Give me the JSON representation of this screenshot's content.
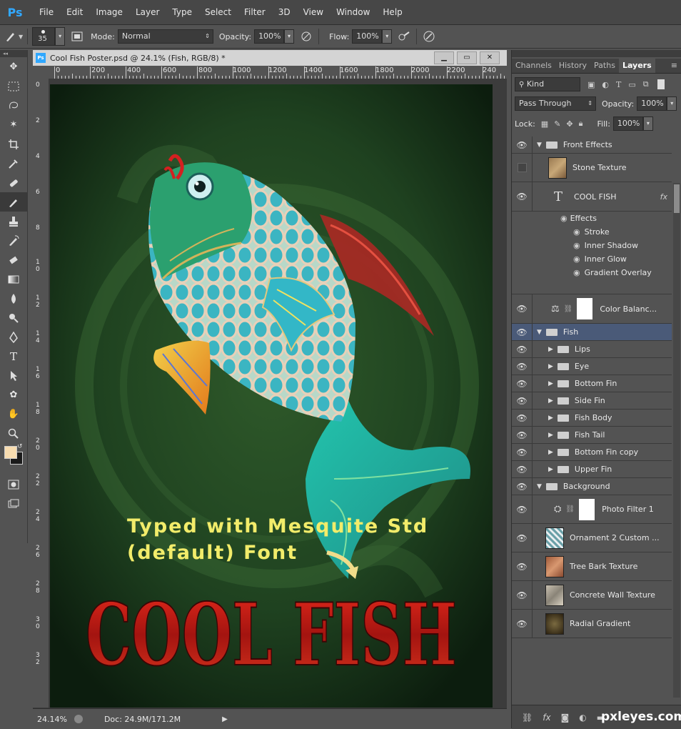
{
  "app": {
    "logo": "Ps"
  },
  "menu": [
    "File",
    "Edit",
    "Image",
    "Layer",
    "Type",
    "Select",
    "Filter",
    "3D",
    "View",
    "Window",
    "Help"
  ],
  "options": {
    "brush_size": "35",
    "mode_label": "Mode:",
    "mode_value": "Normal",
    "opacity_label": "Opacity:",
    "opacity_value": "100%",
    "flow_label": "Flow:",
    "flow_value": "100%"
  },
  "document": {
    "title": "Cool Fish Poster.psd @ 24.1% (Fish, RGB/8) *",
    "ruler_h": [
      "0",
      "200",
      "400",
      "600",
      "800",
      "1000",
      "1200",
      "1400",
      "1600",
      "1800",
      "2000",
      "2200",
      "240"
    ],
    "ruler_v": [
      "0",
      "2",
      "4",
      "6",
      "8",
      "1 0",
      "1 2",
      "1 4",
      "1 6",
      "1 8",
      "2 0",
      "2 2",
      "2 4",
      "2 6",
      "2 8",
      "3 0",
      "3 2"
    ],
    "zoom": "24.14%",
    "doc_size": "Doc: 24.9M/171.2M",
    "annotation_line1": "Typed with Mesquite Std",
    "annotation_line2": "(default) Font",
    "poster_title": "COOL FISH"
  },
  "panel": {
    "tabs": [
      "Channels",
      "History",
      "Paths",
      "Layers"
    ],
    "active_tab": "Layers",
    "filter_kind": "Kind",
    "blend_mode": "Pass Through",
    "opacity_label": "Opacity:",
    "opacity_value": "100%",
    "lock_label": "Lock:",
    "fill_label": "Fill:",
    "fill_value": "100%",
    "layers": [
      {
        "name": "Front Effects",
        "kind": "group-open"
      },
      {
        "name": "Stone Texture",
        "kind": "image"
      },
      {
        "name": "COOL FISH",
        "kind": "text"
      },
      {
        "name": "Effects",
        "kind": "effect-head"
      },
      {
        "name": "Stroke",
        "kind": "effect"
      },
      {
        "name": "Inner Shadow",
        "kind": "effect"
      },
      {
        "name": "Inner Glow",
        "kind": "effect"
      },
      {
        "name": "Gradient Overlay",
        "kind": "effect"
      },
      {
        "name": "Color Balanc...",
        "kind": "adjust"
      },
      {
        "name": "Fish",
        "kind": "group-open"
      },
      {
        "name": "Lips",
        "kind": "group"
      },
      {
        "name": "Eye",
        "kind": "group"
      },
      {
        "name": "Bottom Fin",
        "kind": "group"
      },
      {
        "name": "Side Fin",
        "kind": "group"
      },
      {
        "name": "Fish Body",
        "kind": "group"
      },
      {
        "name": "Fish Tail",
        "kind": "group"
      },
      {
        "name": "Bottom Fin copy",
        "kind": "group"
      },
      {
        "name": "Upper Fin",
        "kind": "group"
      },
      {
        "name": "Background",
        "kind": "group-open"
      },
      {
        "name": "Photo Filter 1",
        "kind": "adjust"
      },
      {
        "name": "Ornament 2 Custom ...",
        "kind": "image"
      },
      {
        "name": "Tree Bark Texture",
        "kind": "image"
      },
      {
        "name": "Concrete Wall Texture",
        "kind": "image"
      },
      {
        "name": "Radial Gradient",
        "kind": "image"
      }
    ]
  },
  "watermark": "pxleyes.com",
  "colors": {
    "accent": "#31a8ff",
    "selected": "#4a5a78",
    "poster_bg": "#1f3d1f",
    "title_red": "#c01818",
    "annotation": "#f2ec6a"
  }
}
